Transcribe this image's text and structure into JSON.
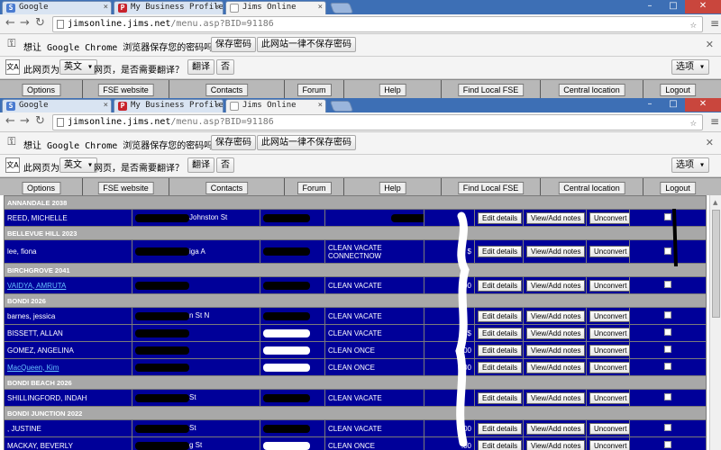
{
  "browser": {
    "tabs": [
      {
        "label": "Google",
        "icon": "google-icon",
        "active": false
      },
      {
        "label": "My Business Profile | M",
        "icon": "pinterest-icon",
        "active": false
      },
      {
        "label": "Jims Online",
        "icon": "page-icon",
        "active": true
      }
    ],
    "address": {
      "host": "jimsonline.jims.net",
      "path": "/menu.asp?BID=91186"
    },
    "password_bar": {
      "text": "想让 Google Chrome 浏览器保存您的密码吗？",
      "save_label": "保存密码",
      "never_label": "此网站一律不保存密码"
    },
    "translate_bar": {
      "prefix": "此网页为",
      "language": "英文",
      "suffix": "网页，是否需要翻译？",
      "translate_label": "翻译",
      "no_label": "否",
      "options_label": "选项"
    }
  },
  "nav": {
    "items": [
      "Options",
      "FSE website",
      "Contacts",
      "Forum",
      "Help",
      "Find Local FSE",
      "Central location",
      "Logout"
    ]
  },
  "table": {
    "action_labels": {
      "edit": "Edit details",
      "notes": "View/Add notes",
      "unconvert": "Unconvert"
    },
    "groups": [
      {
        "heading": "ANNANDALE 2038",
        "rows": [
          {
            "name": "REED, MICHELLE",
            "link": false,
            "address": "Johnston St",
            "service": "",
            "amount": "",
            "tall": false
          }
        ]
      },
      {
        "heading": "BELLEVUE HILL 2023",
        "rows": [
          {
            "name": "lee, fiona",
            "link": false,
            "address": "iga A",
            "service": "CLEAN VACATE CONNECTNOW",
            "amount": "$",
            "tall": true
          }
        ]
      },
      {
        "heading": "BIRCHGROVE 2041",
        "rows": [
          {
            "name": "VAIDYA, AMRUTA",
            "link": true,
            "address": "",
            "service": "CLEAN VACATE",
            "amount": ".00",
            "tall": false
          }
        ]
      },
      {
        "heading": "BONDI 2026",
        "rows": [
          {
            "name": "barnes, jessica",
            "link": false,
            "address": "n St N",
            "service": "CLEAN VACATE",
            "amount": "",
            "tall": false
          },
          {
            "name": "BISSETT, ALLAN",
            "link": false,
            "address": "",
            "service": "CLEAN VACATE",
            "amount": "$",
            "tall": false
          },
          {
            "name": "GOMEZ, ANGELINA",
            "link": false,
            "address": "",
            "service": "CLEAN ONCE",
            "amount": ".00",
            "tall": false
          },
          {
            "name": "MacQueen, Kim",
            "link": true,
            "address": "",
            "service": "CLEAN ONCE",
            "amount": ".00",
            "tall": false
          }
        ]
      },
      {
        "heading": "BONDI BEACH 2026",
        "rows": [
          {
            "name": "SHILLINGFORD, INDAH",
            "link": false,
            "address": "St",
            "service": "CLEAN VACATE",
            "amount": "",
            "tall": false
          }
        ]
      },
      {
        "heading": "BONDI JUNCTION 2022",
        "rows": [
          {
            "name": ", JUSTINE",
            "link": false,
            "address": "St",
            "service": "CLEAN VACATE",
            "amount": ".00",
            "tall": false
          },
          {
            "name": "MACKAY, BEVERLY",
            "link": false,
            "address": "g St",
            "service": "CLEAN ONCE",
            "amount": ".00",
            "tall": false
          }
        ]
      }
    ]
  },
  "colors": {
    "row_background": "#000099",
    "group_background": "#a8a8a8",
    "nav_background": "#b8b8b8",
    "tabstrip": "#3d6fb5"
  }
}
